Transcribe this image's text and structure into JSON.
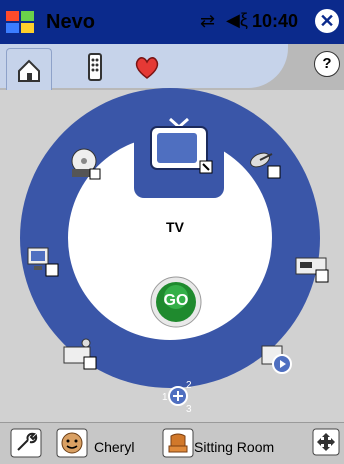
{
  "titlebar": {
    "app_title": "Nevo",
    "time": "10:40"
  },
  "tabs": [
    {
      "name": "Home",
      "icon": "home-icon",
      "active": true
    },
    {
      "name": "Remote",
      "icon": "remote-icon",
      "active": false
    },
    {
      "name": "Favorites",
      "icon": "heart-icon",
      "active": false
    }
  ],
  "center": {
    "device_label": "TV",
    "go_label": "GO"
  },
  "devices": [
    {
      "icon": "tv-icon"
    },
    {
      "icon": "satellite-icon"
    },
    {
      "icon": "vcr-icon"
    },
    {
      "icon": "media-player-icon"
    },
    {
      "icon": "add-device-icon"
    },
    {
      "icon": "stereo-icon"
    },
    {
      "icon": "pc-icon"
    },
    {
      "icon": "dvd-icon"
    }
  ],
  "bottombar": {
    "user_name": "Cheryl",
    "room_name": "Sitting Room"
  },
  "colors": {
    "titlebar": "#0b2a8c",
    "ring": "#3a56a8",
    "go_green": "#1f8a2e"
  }
}
